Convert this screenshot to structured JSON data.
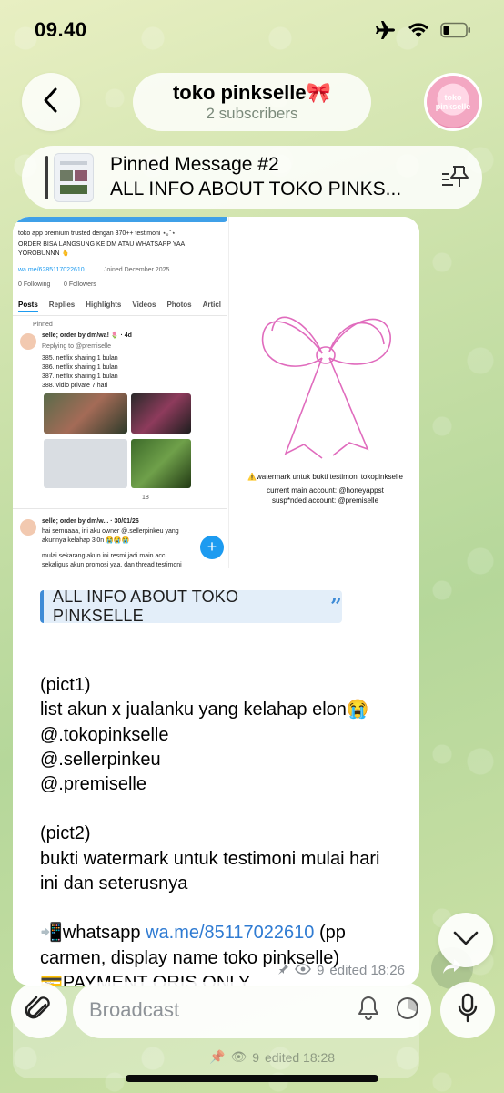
{
  "status": {
    "time": "09.40"
  },
  "header": {
    "title": "toko pinkselle🎀",
    "subtitle": "2 subscribers",
    "avatar_text": "toko pinkselle"
  },
  "pinned": {
    "title": "Pinned Message #2",
    "text": "ALL INFO ABOUT TOKO PINKS..."
  },
  "media": {
    "bio_line1": "toko app premium trusted dengan 370++ testimoni ⋆｡˚⋆",
    "bio_line2": "ORDER BISA LANGSUNG KE DM ATAU WHATSAPP YAA",
    "bio_line3": "YOROBUNNN 🫰",
    "link": "wa.me/6285117022610",
    "joined": "Joined December 2025",
    "following": "0 Following",
    "followers": "0 Followers",
    "tabs": [
      "Posts",
      "Replies",
      "Highlights",
      "Videos",
      "Photos",
      "Articl"
    ],
    "pinned_label": "Pinned",
    "post1_header": "selle; order by dm/wa! 🌷 · 4d",
    "post1_reply": "Replying to @premiselle",
    "post1_lines": [
      "385. netflix sharing 1 bulan",
      "386. netflix sharing 1 bulan",
      "387. netflix sharing 1 bulan",
      "388. vidio private 7 hari"
    ],
    "post1_count": "18",
    "post2_header": "selle; order by dm/w... · 30/01/26",
    "post2_lines": [
      "hai semuaaa, ini aku owner @.sellerpinkeu yang",
      "akunnya kelahap 3l0n 😭😭😭",
      "",
      "mulai sekarang akun ini resmi jadi main acc",
      "sekaligus akun promosi yaa, dan thread testimoni"
    ],
    "wm_caption": "⚠️watermark untuk bukti testimoni tokopinkselle",
    "wm_main": "current main account: @honeyappst",
    "wm_susp": "susp*nded account: @premiselle"
  },
  "message": {
    "quote": "ALL INFO ABOUT TOKO PINKSELLE",
    "lines": [
      "",
      "(pict1)",
      "list akun x jualanku yang kelahap elon😭",
      "@.tokopinkselle",
      "@.sellerpinkeu",
      "@.premiselle",
      "",
      "(pict2)",
      "bukti watermark untuk testimoni mulai hari",
      "ini dan seterusnya",
      ""
    ],
    "wa_prefix": "📲whatsapp ",
    "wa_link": "wa.me/85117022610",
    "wa_suffix": " (pp",
    "line_carmen": "carmen, display name toko pinkselle)",
    "line_payment": "💳PAYMENT QRIS ONLY",
    "views": "9",
    "edited": "edited 18:26"
  },
  "ghost": {
    "views": "9",
    "edited": "edited 18:28"
  },
  "input": {
    "placeholder": "Broadcast"
  }
}
